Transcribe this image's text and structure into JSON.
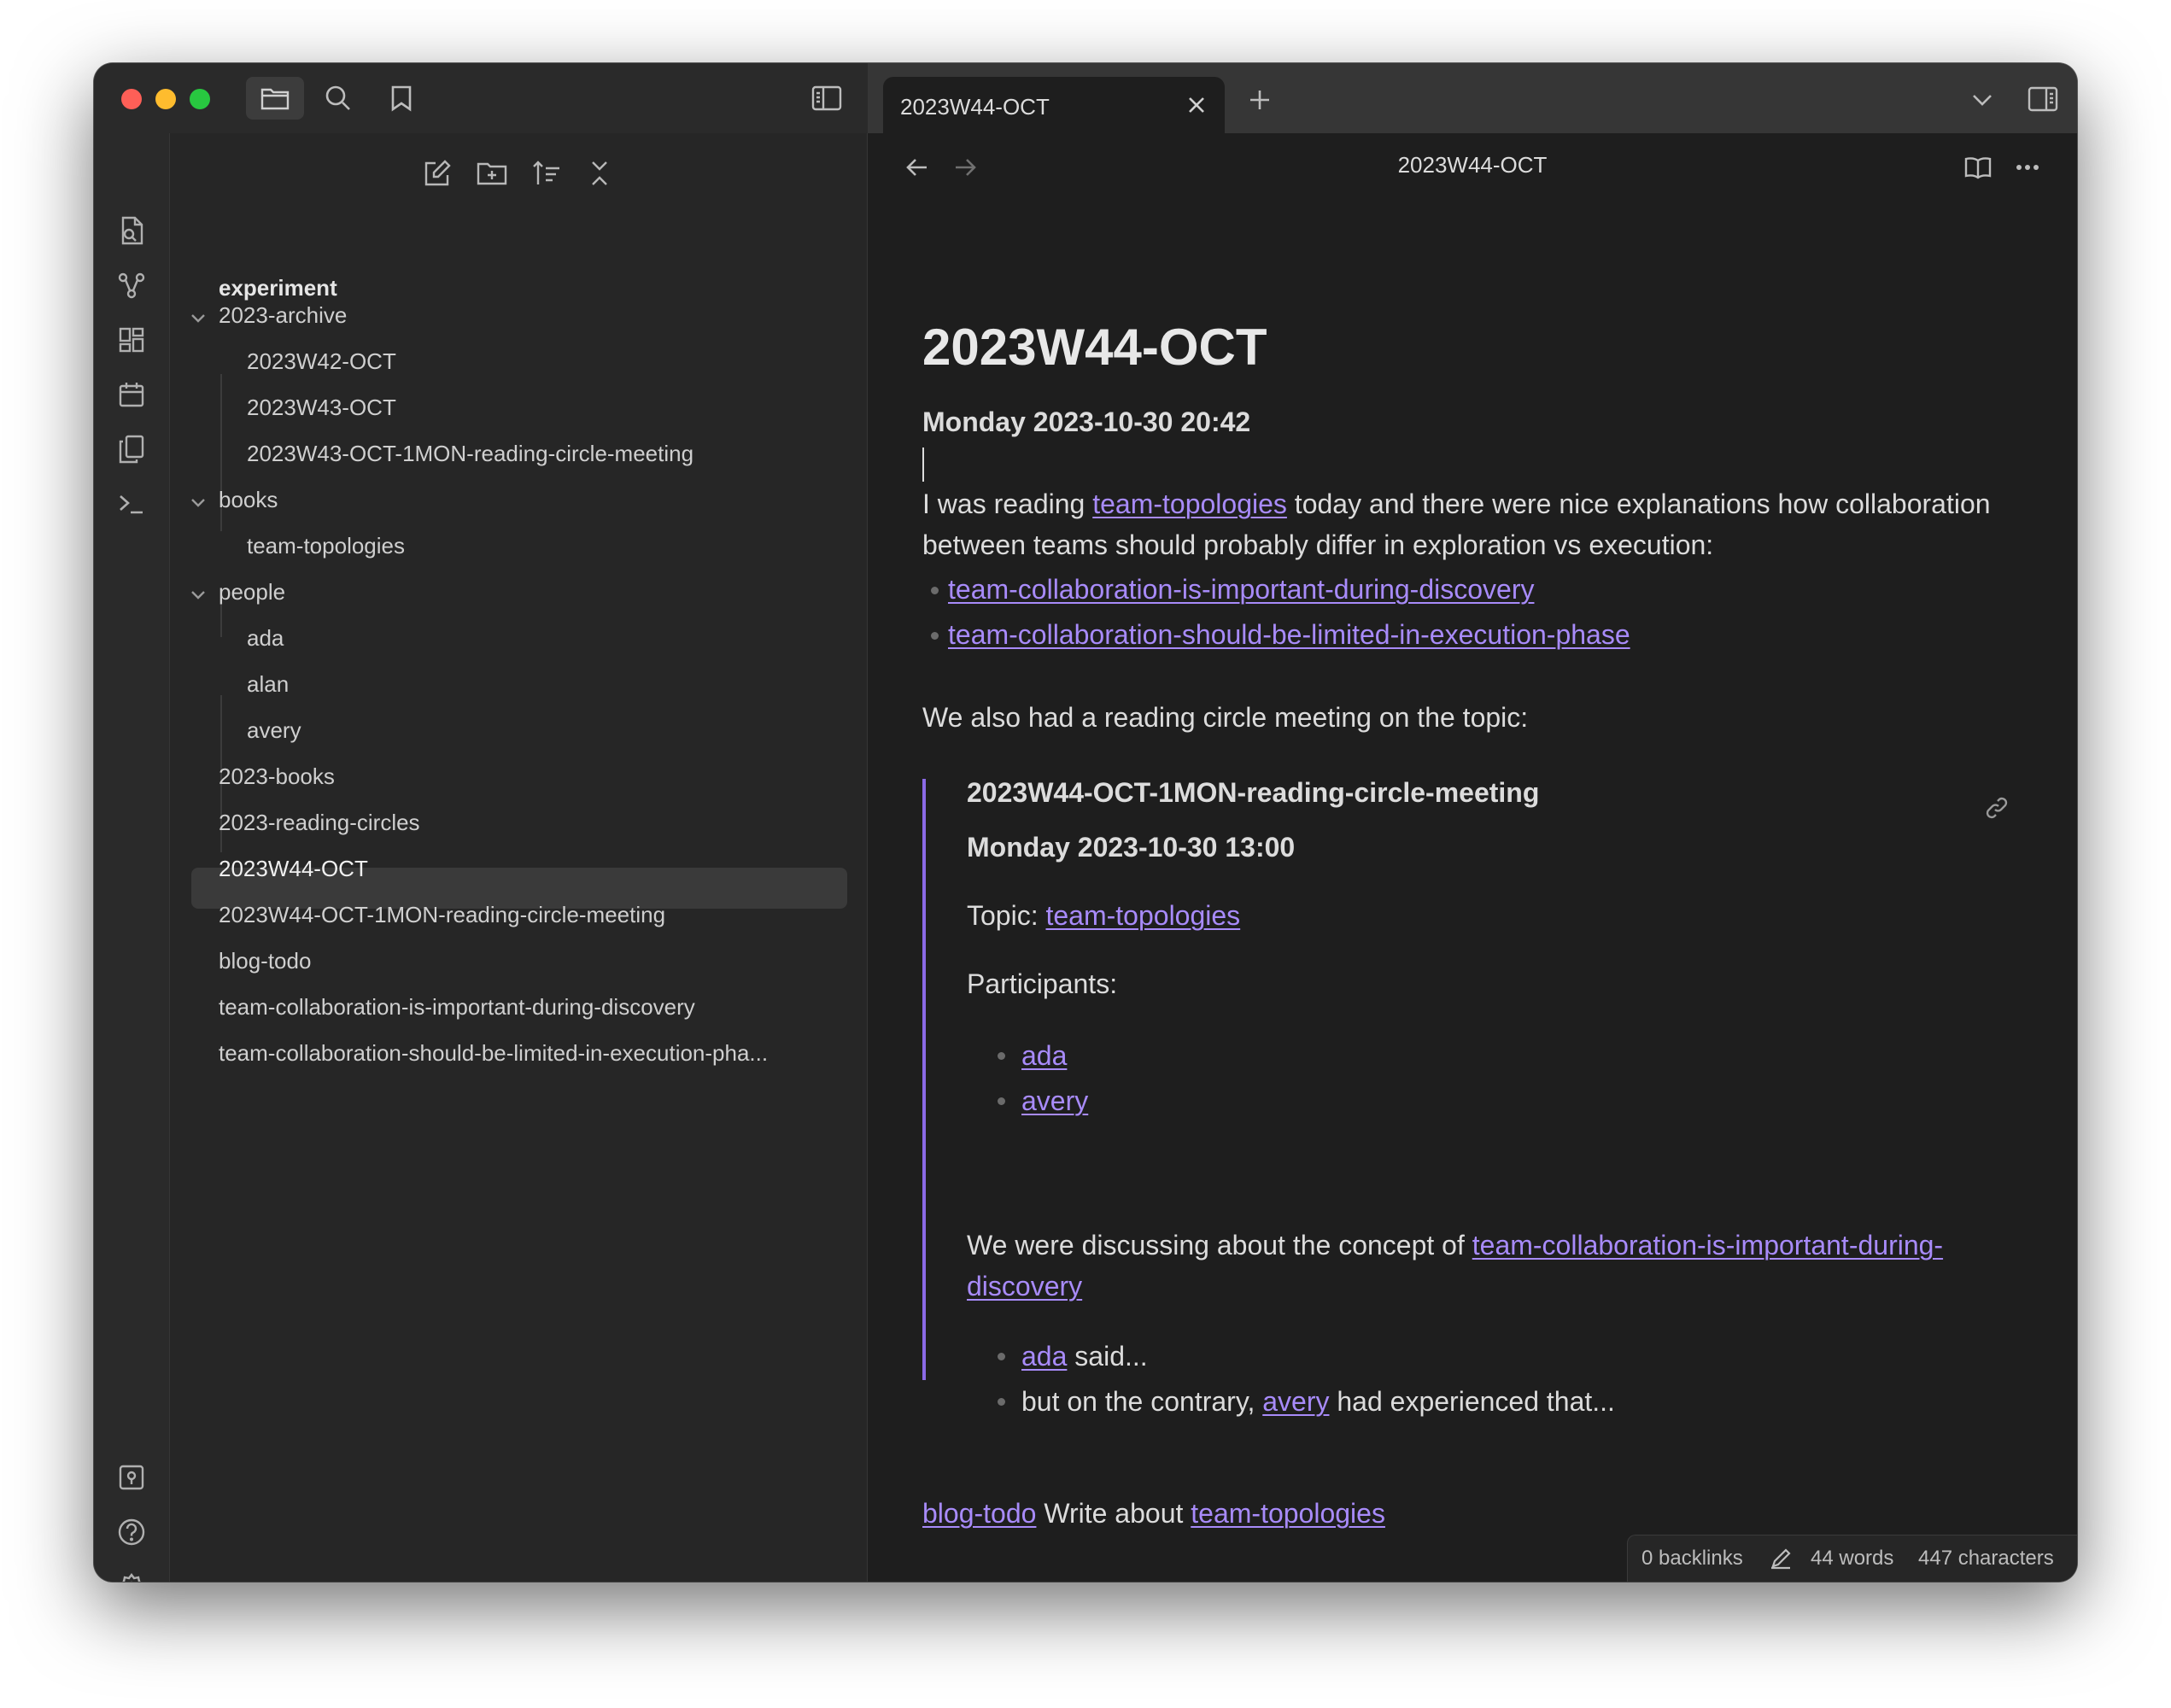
{
  "window": {
    "tab_title": "2023W44-OCT",
    "colors": {
      "accent_link": "#a88bfa",
      "embed_bar": "#8b6ae6",
      "traffic_red": "#fe5f57",
      "traffic_yellow": "#febc2e",
      "traffic_green": "#28c840"
    }
  },
  "titlebar": {
    "left_icons": [
      "folder-icon",
      "search-icon",
      "bookmark-icon",
      "sidebar-toggle-icon"
    ],
    "right_icons": [
      "new-tab-icon",
      "chevron-down-icon",
      "right-sidebar-toggle-icon"
    ]
  },
  "ribbon": {
    "top_icons": [
      "open-quick-switcher-icon",
      "graph-view-icon",
      "canvas-icon",
      "daily-note-icon",
      "templates-icon",
      "command-palette-icon"
    ],
    "bottom_icons": [
      "vault-switcher-icon",
      "help-icon",
      "settings-icon"
    ]
  },
  "sidebar": {
    "tool_icons": [
      "new-note-icon",
      "new-folder-icon",
      "sort-icon",
      "collapse-all-icon"
    ],
    "vault_name": "experiment",
    "items": [
      {
        "label": "2023-archive",
        "folder": true
      },
      {
        "label": "2023W42-OCT"
      },
      {
        "label": "2023W43-OCT"
      },
      {
        "label": "2023W43-OCT-1MON-reading-circle-meeting"
      },
      {
        "label": "books",
        "folder": true
      },
      {
        "label": "team-topologies"
      },
      {
        "label": "people",
        "folder": true
      },
      {
        "label": "ada"
      },
      {
        "label": "alan"
      },
      {
        "label": "avery"
      },
      {
        "label": "2023-books"
      },
      {
        "label": "2023-reading-circles"
      },
      {
        "label": "2023W44-OCT",
        "selected": true
      },
      {
        "label": "2023W44-OCT-1MON-reading-circle-meeting"
      },
      {
        "label": "blog-todo"
      },
      {
        "label": "team-collaboration-is-important-during-discovery"
      },
      {
        "label": "team-collaboration-should-be-limited-in-execution-pha..."
      }
    ]
  },
  "editor": {
    "nav_title": "2023W44-OCT",
    "title": "2023W44-OCT",
    "date_heading": "Monday 2023-10-30 20:42",
    "intro_1": "I was reading ",
    "intro_link": "team-topologies",
    "intro_2": " today and there were nice explanations how collaboration between teams should probably differ in exploration vs execution:",
    "links": [
      "team-collaboration-is-important-during-discovery",
      "team-collaboration-should-be-limited-in-execution-phase"
    ],
    "also_text": "We also had a reading circle meeting on the topic:",
    "embed": {
      "title": "2023W44-OCT-1MON-reading-circle-meeting",
      "date": "Monday 2023-10-30 13:00",
      "topic_label": "Topic: ",
      "topic_link": "team-topologies",
      "participants_label": "Participants:",
      "participants": [
        "ada",
        "avery"
      ],
      "discuss_1": "We were discussing about the concept of ",
      "discuss_link_a": "team-collaboration-is-important-during-",
      "discuss_link_b": "discovery",
      "said_link": "ada",
      "said_text": " said...",
      "contrary_1": "but on the contrary, ",
      "contrary_link": "avery",
      "contrary_2": " had experienced that..."
    },
    "footer_link_1": "blog-todo",
    "footer_text": " Write about ",
    "footer_link_2": "team-topologies"
  },
  "statusbar": {
    "backlinks": "0 backlinks",
    "words": "44 words",
    "characters": "447 characters"
  }
}
